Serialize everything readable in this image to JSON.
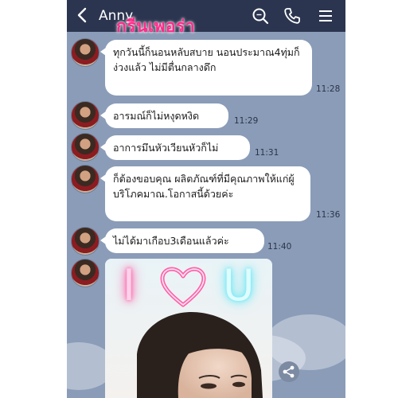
{
  "header": {
    "back_icon": "back-arrow-icon",
    "contact_name": "Anny",
    "overlay_text": "กรีนเพอร่า",
    "icons": [
      "search-icon",
      "phone-icon",
      "menu-icon"
    ]
  },
  "messages": [
    {
      "text": "ทุกวันนี้ก็นอนหลับสบาย นอนประมาณ4ทุ่มก็ง่วงแล้ว ไม่มีตื่นกลางดึก",
      "time": "11:28"
    },
    {
      "text": "อารมณ์ก็ไม่หงุดหงิด",
      "time": "11:29"
    },
    {
      "text": "อาการมึนหัวเวียนหัวก็ไม่",
      "time": "11:31"
    },
    {
      "text": "ก็ต้องขอบคุณ ผลิตภัณฑ์ที่มีคุณภาพให้แก่ผู้บริโภคมาณ.โอกาสนี้ด้วยค่ะ",
      "time": "11:36"
    },
    {
      "text": "ไม่ได้มาเกือบ3เดือนแล้วค่ะ",
      "time": "11:40"
    }
  ],
  "photo": {
    "neon_left": "I",
    "neon_right": "U",
    "heart_icon": "heart-icon"
  },
  "share_icon": "share-icon",
  "colors": {
    "topbar": "#2c3550",
    "chat_bg": "#8a9cb8",
    "bubble": "#ffffff",
    "overlay_text": "#ff2a8a",
    "neon_pink": "#ff5fa8",
    "neon_cyan": "#6fe9f5"
  }
}
